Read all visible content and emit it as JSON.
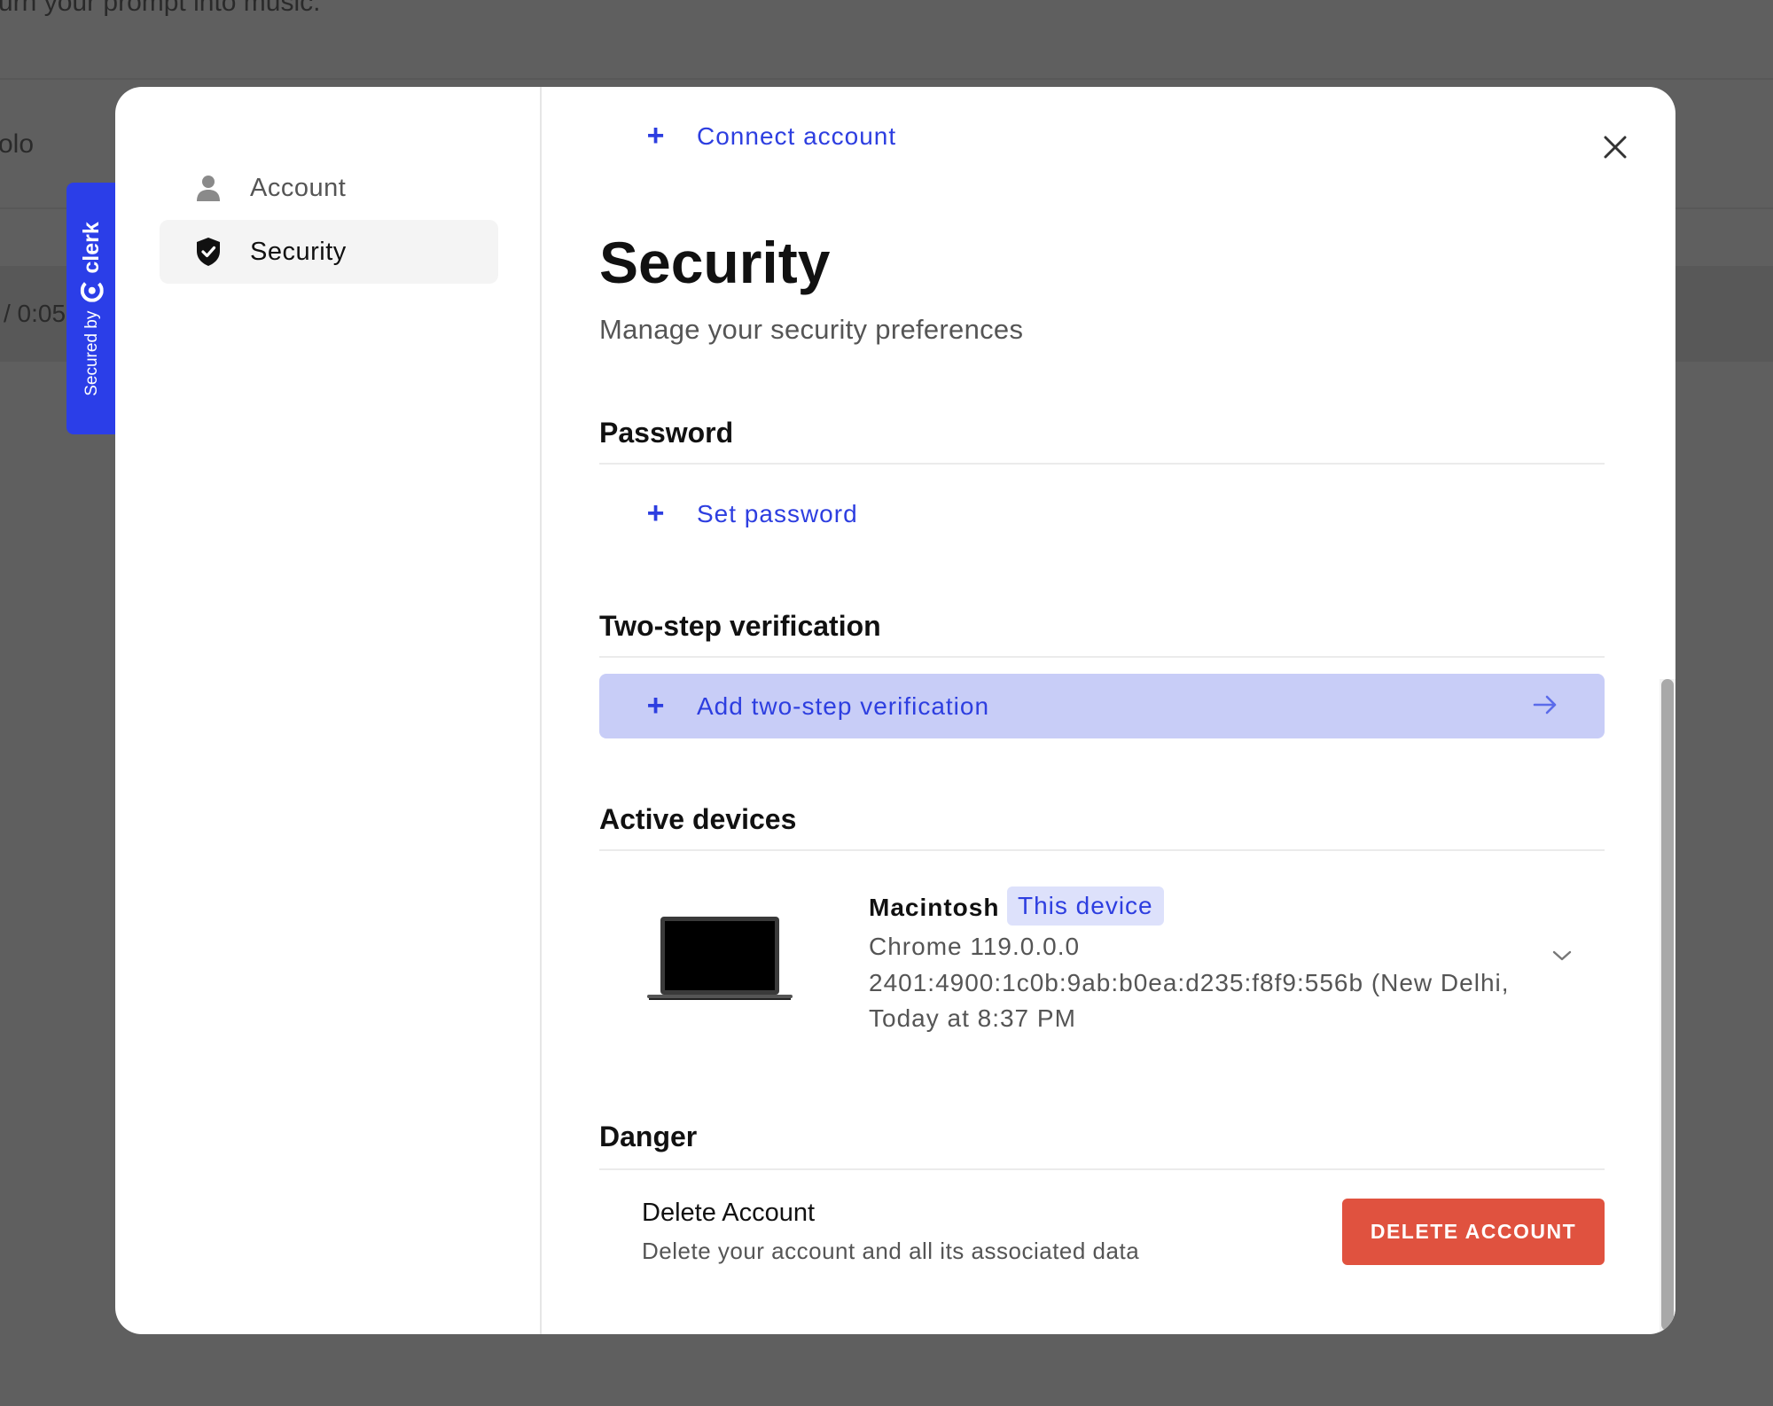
{
  "background": {
    "prompt_text": "urn your prompt into music.",
    "solo_text": "olo",
    "time_text": "/ 0:05"
  },
  "clerk_badge": {
    "secured_by": "Secured by",
    "brand": "clerk"
  },
  "sidebar": {
    "items": [
      {
        "label": "Account",
        "icon": "user-icon",
        "active": false
      },
      {
        "label": "Security",
        "icon": "shield-check-icon",
        "active": true
      }
    ]
  },
  "main": {
    "connect_account": "Connect account",
    "title": "Security",
    "subtitle": "Manage your security preferences",
    "password": {
      "heading": "Password",
      "action": "Set password"
    },
    "two_step": {
      "heading": "Two-step verification",
      "action": "Add two-step verification"
    },
    "active_devices": {
      "heading": "Active devices",
      "device": {
        "name": "Macintosh",
        "badge": "This device",
        "browser": "Chrome 119.0.0.0",
        "location": "2401:4900:1c0b:9ab:b0ea:d235:f8f9:556b (New Delhi,",
        "last_active": "Today at 8:37 PM"
      }
    },
    "danger": {
      "heading": "Danger",
      "delete_title": "Delete Account",
      "delete_description": "Delete your account and all its associated data",
      "delete_button": "DELETE ACCOUNT"
    }
  },
  "colors": {
    "accent": "#2d3ee0",
    "highlight": "#c8cdf7",
    "danger": "#e0523f",
    "clerk_blue": "#2b3ee8"
  }
}
